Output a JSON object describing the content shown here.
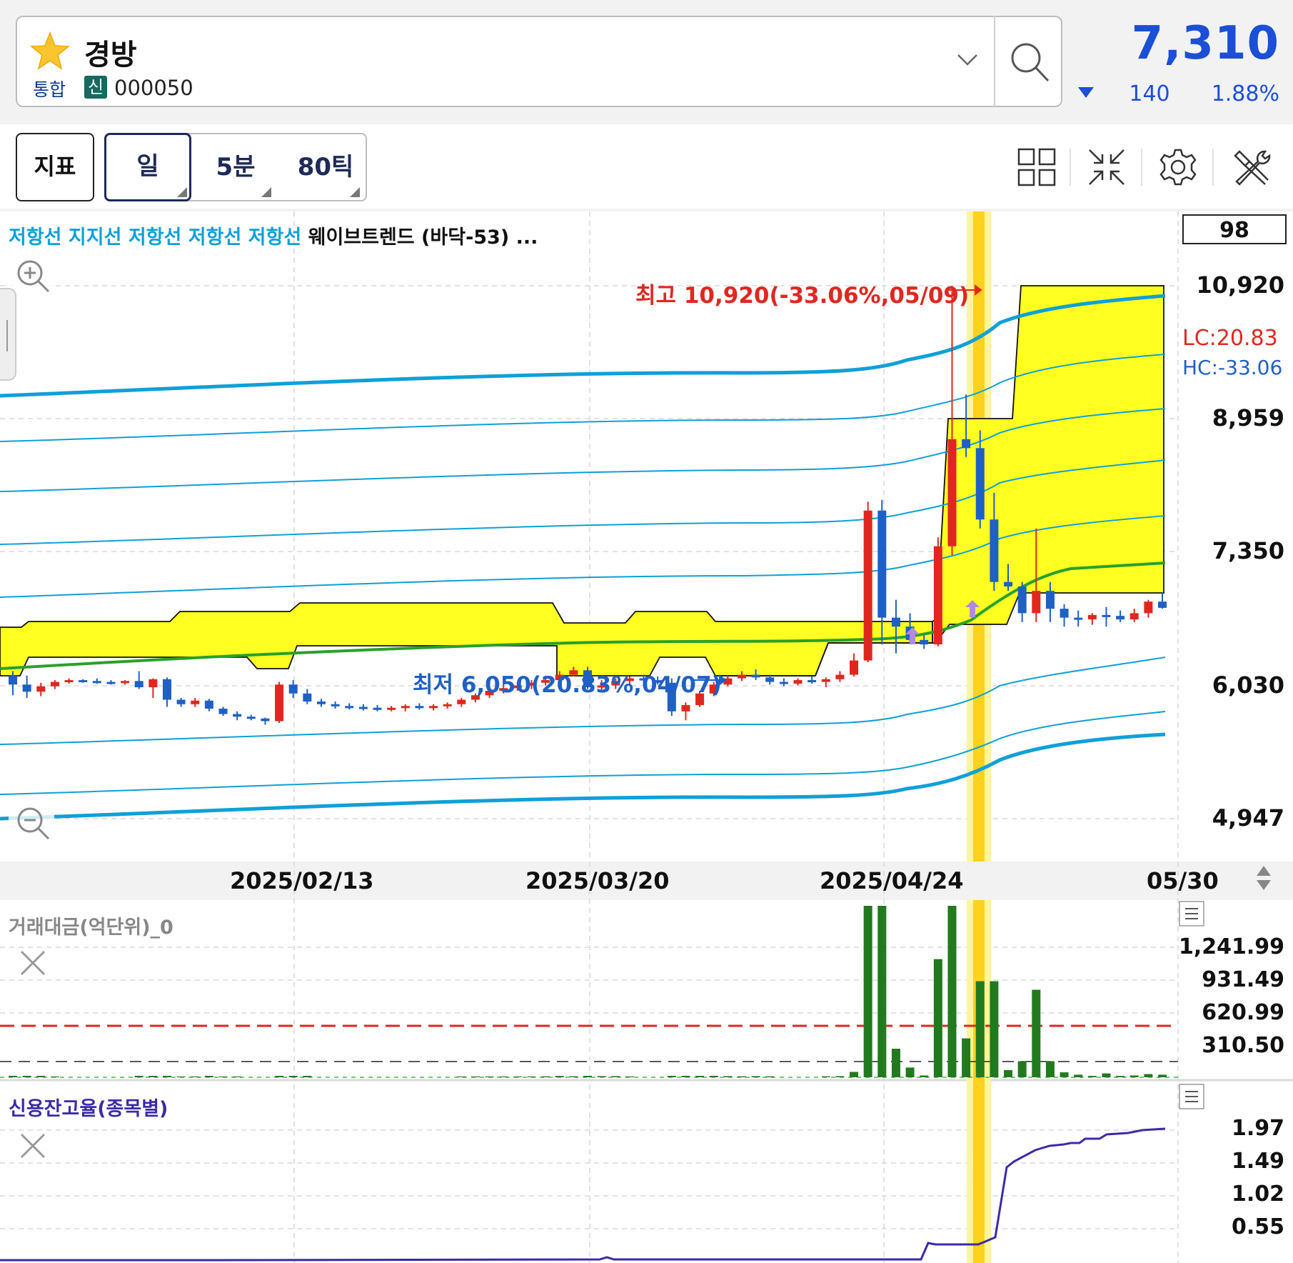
{
  "stock": {
    "name": "경방",
    "market": "통합",
    "credit_badge": "신",
    "code": "000050",
    "price": "7,310",
    "change": "140",
    "change_rate": "1.88%",
    "change_direction": "down",
    "price_color": "#1a4fd6"
  },
  "toolbar": {
    "indicator_label": "지표",
    "periods": [
      {
        "label": "일",
        "selected": true
      },
      {
        "label": "5분",
        "selected": false
      },
      {
        "label": "80틱",
        "selected": false
      }
    ],
    "icons": [
      "layout-grid-icon",
      "collapse-icon",
      "gear-icon",
      "tools-icon"
    ]
  },
  "chart": {
    "legend_blue": "저항선 지지선 저항선 저항선 저항선",
    "legend_black": "웨이브트렌드 (바닥-53) ...",
    "period_count": "98",
    "lc_label": "LC:20.83",
    "hc_label": "HC:-33.06",
    "y_ticks": [
      "10,920",
      "8,959",
      "7,350",
      "6,030",
      "4,947"
    ],
    "x_ticks": [
      "2025/02/13",
      "2025/03/20",
      "2025/04/24",
      "05/30"
    ],
    "high_annotation": "최고 10,920(-33.06%,05/09)",
    "low_annotation": "최저 6,050(20.83%,04/07)",
    "colors": {
      "up": "#e0271f",
      "down": "#1f60c4",
      "band_line": "#0fa0d8",
      "ma": "#2aa02a",
      "box": "#ffff22",
      "highlight": "#ffd21e"
    }
  },
  "chart_data": {
    "type": "candlestick",
    "ylim": [
      4900,
      11000
    ],
    "candles_note": "approximate daily OHLC values read from chart",
    "candles": [
      [
        6550,
        6600,
        6330,
        6450
      ],
      [
        6450,
        6550,
        6300,
        6370
      ],
      [
        6370,
        6470,
        6320,
        6430
      ],
      [
        6430,
        6500,
        6400,
        6480
      ],
      [
        6480,
        6520,
        6460,
        6500
      ],
      [
        6500,
        6510,
        6470,
        6490
      ],
      [
        6490,
        6520,
        6460,
        6480
      ],
      [
        6480,
        6500,
        6450,
        6470
      ],
      [
        6470,
        6500,
        6450,
        6490
      ],
      [
        6490,
        6600,
        6400,
        6420
      ],
      [
        6420,
        6520,
        6300,
        6510
      ],
      [
        6510,
        6530,
        6200,
        6280
      ],
      [
        6280,
        6300,
        6200,
        6230
      ],
      [
        6230,
        6300,
        6200,
        6270
      ],
      [
        6270,
        6290,
        6150,
        6180
      ],
      [
        6180,
        6200,
        6100,
        6120
      ],
      [
        6120,
        6150,
        6050,
        6090
      ],
      [
        6090,
        6110,
        6050,
        6070
      ],
      [
        6070,
        6080,
        6000,
        6040
      ],
      [
        6040,
        6480,
        6020,
        6450
      ],
      [
        6450,
        6500,
        6300,
        6350
      ],
      [
        6350,
        6400,
        6230,
        6260
      ],
      [
        6260,
        6290,
        6200,
        6230
      ],
      [
        6230,
        6260,
        6180,
        6210
      ],
      [
        6210,
        6240,
        6170,
        6200
      ],
      [
        6200,
        6230,
        6160,
        6190
      ],
      [
        6190,
        6220,
        6150,
        6180
      ],
      [
        6180,
        6210,
        6150,
        6190
      ],
      [
        6190,
        6230,
        6150,
        6210
      ],
      [
        6210,
        6240,
        6170,
        6190
      ],
      [
        6190,
        6230,
        6160,
        6210
      ],
      [
        6210,
        6250,
        6180,
        6230
      ],
      [
        6230,
        6300,
        6200,
        6280
      ],
      [
        6280,
        6350,
        6250,
        6330
      ],
      [
        6330,
        6400,
        6300,
        6380
      ],
      [
        6380,
        6450,
        6350,
        6410
      ],
      [
        6410,
        6480,
        6380,
        6440
      ],
      [
        6440,
        6500,
        6400,
        6470
      ],
      [
        6470,
        6550,
        6440,
        6500
      ],
      [
        6500,
        6600,
        6470,
        6560
      ],
      [
        6560,
        6650,
        6540,
        6610
      ],
      [
        6610,
        6650,
        6400,
        6420
      ],
      [
        6420,
        6500,
        6380,
        6440
      ],
      [
        6440,
        6520,
        6400,
        6490
      ],
      [
        6490,
        6540,
        6440,
        6520
      ],
      [
        6520,
        6560,
        6480,
        6500
      ],
      [
        6500,
        6540,
        6450,
        6470
      ],
      [
        6470,
        6520,
        6100,
        6150
      ],
      [
        6150,
        6250,
        6050,
        6220
      ],
      [
        6220,
        6380,
        6200,
        6350
      ],
      [
        6350,
        6480,
        6320,
        6450
      ],
      [
        6450,
        6550,
        6430,
        6520
      ],
      [
        6520,
        6600,
        6490,
        6560
      ],
      [
        6560,
        6620,
        6500,
        6530
      ],
      [
        6530,
        6560,
        6450,
        6480
      ],
      [
        6480,
        6520,
        6430,
        6460
      ],
      [
        6460,
        6520,
        6440,
        6500
      ],
      [
        6500,
        6540,
        6460,
        6480
      ],
      [
        6480,
        6530,
        6420,
        6510
      ],
      [
        6510,
        6600,
        6480,
        6560
      ],
      [
        6560,
        6800,
        6540,
        6720
      ],
      [
        6720,
        8500,
        6700,
        8400
      ],
      [
        8400,
        8520,
        6900,
        7200
      ],
      [
        7200,
        7400,
        6800,
        7100
      ],
      [
        7100,
        7250,
        6900,
        6950
      ],
      [
        6950,
        7000,
        6850,
        6900
      ],
      [
        6900,
        8100,
        6880,
        8000
      ],
      [
        8000,
        10920,
        7900,
        9200
      ],
      [
        9200,
        9700,
        9000,
        9100
      ],
      [
        9100,
        9300,
        8200,
        8300
      ],
      [
        8300,
        8600,
        7500,
        7600
      ],
      [
        7600,
        7800,
        7500,
        7550
      ],
      [
        7550,
        7600,
        7150,
        7250
      ],
      [
        7250,
        8200,
        7150,
        7500
      ],
      [
        7500,
        7600,
        7150,
        7300
      ],
      [
        7300,
        7350,
        7100,
        7200
      ],
      [
        7200,
        7280,
        7100,
        7180
      ],
      [
        7180,
        7250,
        7120,
        7230
      ],
      [
        7230,
        7320,
        7100,
        7220
      ],
      [
        7220,
        7280,
        7150,
        7180
      ],
      [
        7180,
        7300,
        7150,
        7250
      ],
      [
        7250,
        7400,
        7200,
        7380
      ],
      [
        7380,
        7480,
        7300,
        7310
      ]
    ],
    "volume_panel": {
      "title": "거래대금(억단위)_0",
      "y_ticks": [
        "1,241.99",
        "931.49",
        "620.99",
        "310.50"
      ]
    },
    "credit_panel": {
      "title": "신용잔고율(종목별)",
      "y_ticks": [
        "1.97",
        "1.49",
        "1.02",
        "0.55"
      ]
    }
  }
}
